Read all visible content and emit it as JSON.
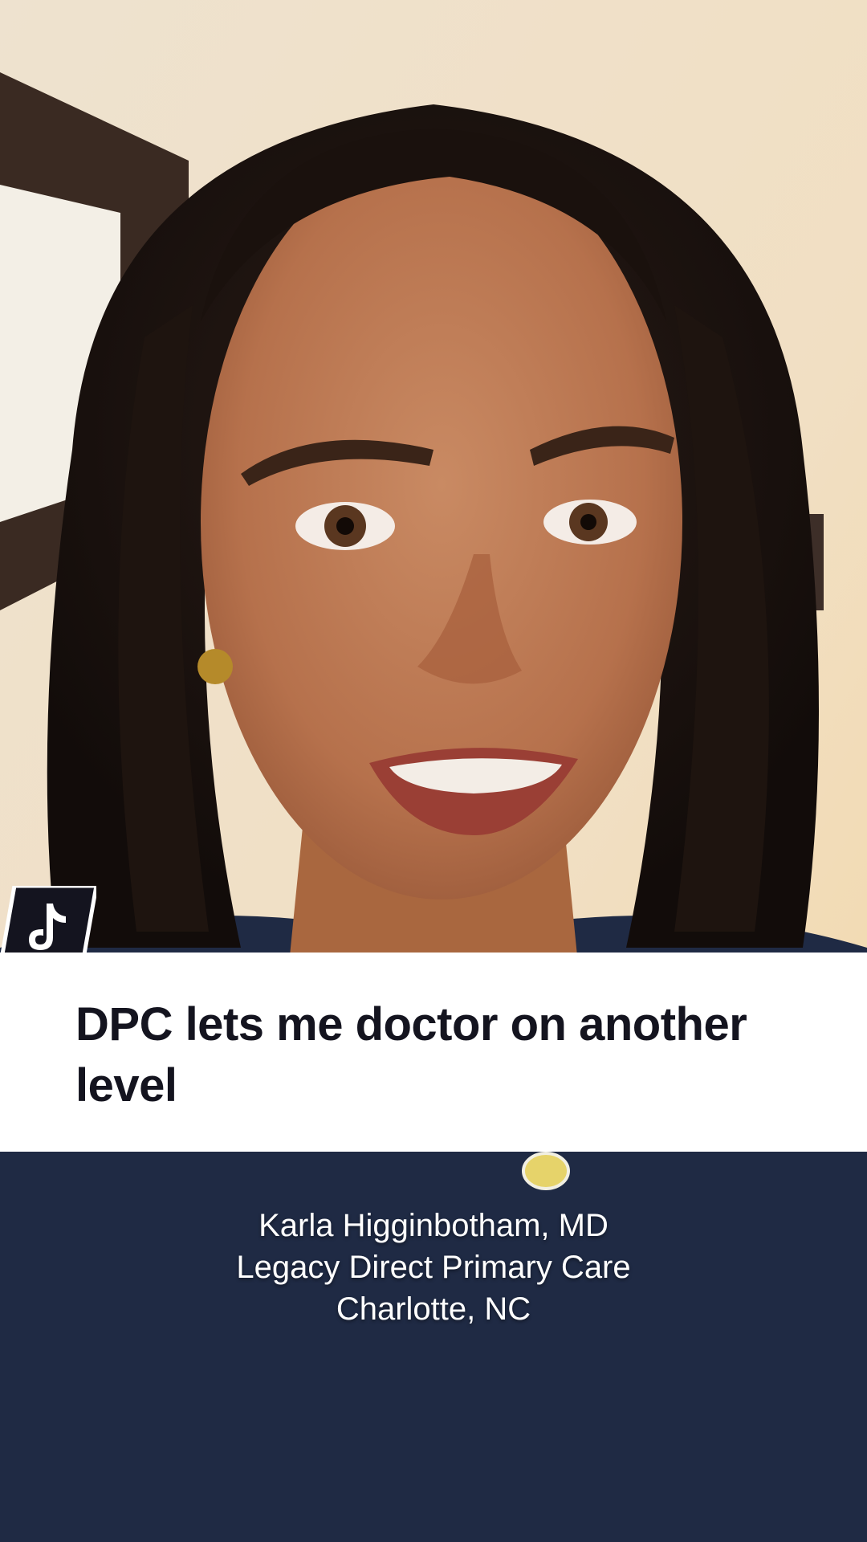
{
  "app": {
    "logo_icon": "tiktok-logo-icon"
  },
  "headline": {
    "text": "DPC lets me doctor on another level"
  },
  "caption": {
    "name": "Karla Higginbotham, MD",
    "practice": "Legacy Direct Primary Care",
    "location": "Charlotte, NC"
  },
  "colors": {
    "banner_background": "#ffffff",
    "headline_text": "#14141f",
    "caption_text": "#ffffff",
    "logo_badge": "#14141f",
    "shirt": "#1f2a44"
  }
}
